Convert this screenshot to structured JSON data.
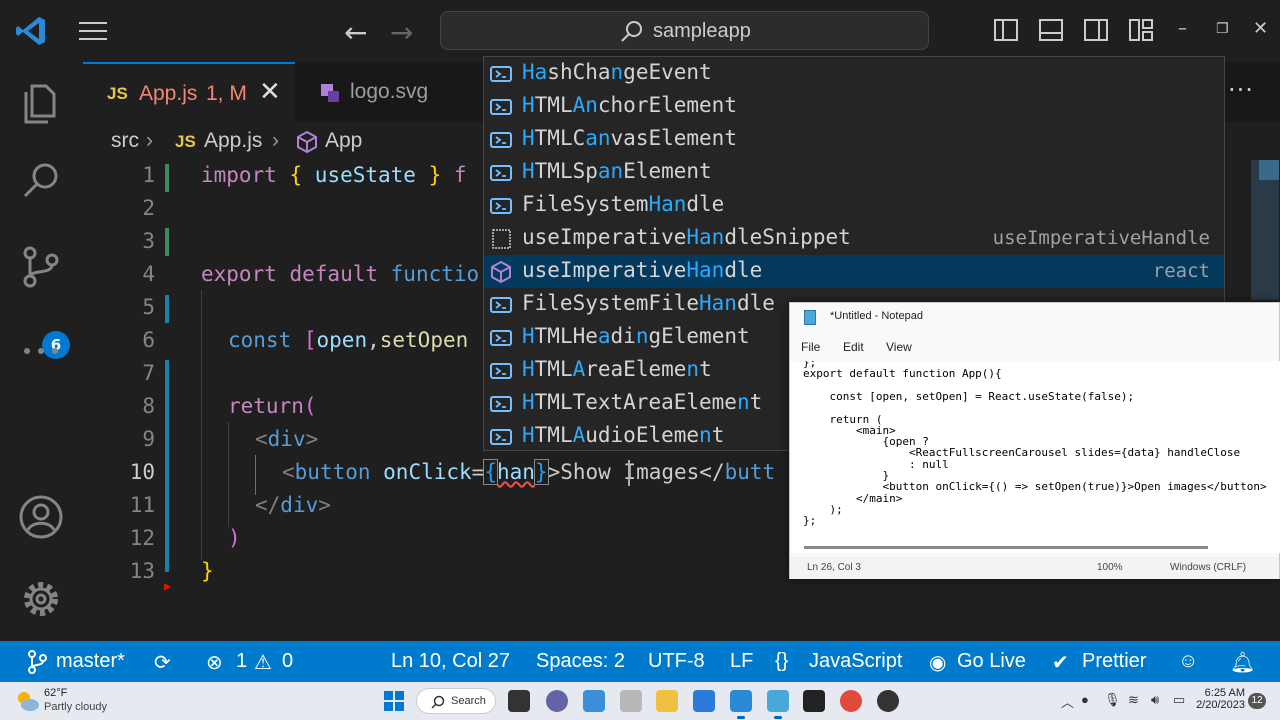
{
  "titlebar": {
    "search_text": "sampleapp"
  },
  "activity": {
    "source_control_badge": "6"
  },
  "tabs": [
    {
      "icon": "JS",
      "name": "App.js",
      "status": "1, M"
    },
    {
      "name": "logo.svg"
    }
  ],
  "breadcrumb": {
    "folder": "src",
    "file_icon": "JS",
    "file": "App.js",
    "symbol": "App"
  },
  "editor": {
    "line_numbers": [
      "1",
      "2",
      "3",
      "4",
      "5",
      "6",
      "7",
      "8",
      "9",
      "10",
      "11",
      "12",
      "13"
    ],
    "lines": {
      "l1": {
        "a": "import",
        "b": " { ",
        "c": "useState",
        "d": " } ",
        "e": "f"
      },
      "l4": {
        "a": "export",
        "b": " default ",
        "c": "functio"
      },
      "l6": {
        "a": "const",
        "b": " [",
        "c": "open",
        "d": ",",
        "e": "setOpen"
      },
      "l8": {
        "a": "return",
        "b": "("
      },
      "l9": {
        "a": "<",
        "b": "div",
        "c": ">"
      },
      "l10": {
        "a": "<",
        "b": "button",
        "c": " onClick",
        "d": "=",
        "e": "{",
        "f": "han",
        "g": "}",
        "h": ">Show Images</",
        "i": "butt"
      },
      "l11": {
        "a": "</",
        "b": "div",
        "c": ">"
      },
      "l12": {
        "a": ")"
      },
      "l13": {
        "a": "}"
      }
    }
  },
  "suggestions": [
    {
      "parts": [
        "",
        "Ha",
        "shCha",
        "n",
        "geEvent"
      ],
      "icon": "variable-icon",
      "detail": ""
    },
    {
      "parts": [
        "",
        "H",
        "TML",
        "An",
        "chorElement"
      ],
      "icon": "variable-icon",
      "detail": ""
    },
    {
      "parts": [
        "",
        "H",
        "TMLC",
        "an",
        "vasElement"
      ],
      "icon": "variable-icon",
      "detail": ""
    },
    {
      "parts": [
        "",
        "H",
        "TMLSp",
        "an",
        "Element"
      ],
      "icon": "variable-icon",
      "detail": ""
    },
    {
      "parts": [
        "FileSystem",
        "Han",
        "dle",
        "",
        ""
      ],
      "icon": "variable-icon",
      "detail": ""
    },
    {
      "parts": [
        "useImperative",
        "Han",
        "dleSnippet",
        "",
        ""
      ],
      "icon": "snippet-icon",
      "detail": "useImperativeHandle"
    },
    {
      "parts": [
        "useImperative",
        "Han",
        "dle",
        "",
        ""
      ],
      "icon": "method-icon",
      "detail": "react"
    },
    {
      "parts": [
        "FileSystemFile",
        "Han",
        "dle",
        "",
        ""
      ],
      "icon": "variable-icon",
      "detail": ""
    },
    {
      "parts": [
        "",
        "H",
        "TMLHe",
        "a",
        "di",
        "n",
        "gElement"
      ],
      "icon": "variable-icon",
      "detail": ""
    },
    {
      "parts": [
        "",
        "H",
        "TML",
        "A",
        "reaEleme",
        "n",
        "t"
      ],
      "icon": "variable-icon",
      "detail": ""
    },
    {
      "parts": [
        "",
        "H",
        "TMLTextArea",
        "",
        "Eleme",
        "n",
        "t"
      ],
      "icon": "variable-icon",
      "detail": ""
    },
    {
      "parts": [
        "",
        "H",
        "TML",
        "A",
        "udioEleme",
        "n",
        "t"
      ],
      "icon": "variable-icon",
      "detail": ""
    }
  ],
  "notepad": {
    "title": "*Untitled - Notepad",
    "menu": [
      "File",
      "Edit",
      "View"
    ],
    "lines": [
      "};",
      "export default function App(){",
      "",
      "    const [open, setOpen] = React.useState(false);",
      "",
      "    return (",
      "        <main>",
      "            {open ?",
      "                <ReactFullscreenCarousel slides={data} handleClose",
      "                : null",
      "            }",
      "            <button onClick={() => setOpen(true)}>Open images</button>",
      "        </main>",
      "    );",
      "};"
    ],
    "status": {
      "position": "Ln 26, Col 3",
      "zoom": "100%",
      "line_ending": "Windows (CRLF)"
    }
  },
  "statusbar": {
    "branch": "master*",
    "errors": "1",
    "warnings": "0",
    "cursor": "Ln 10, Col 27",
    "spaces": "Spaces: 2",
    "encoding": "UTF-8",
    "eol": "LF",
    "language": "JavaScript",
    "golive": "Go Live",
    "prettier": "Prettier"
  },
  "taskbar": {
    "temp": "62°F",
    "weather": "Partly cloudy",
    "search": "Search",
    "time": "6:25 AM",
    "date": "2/20/2023",
    "notifications": "12"
  },
  "colors": {
    "accent": "#007acc",
    "match": "#2aaaff",
    "selection": "#04395e"
  }
}
